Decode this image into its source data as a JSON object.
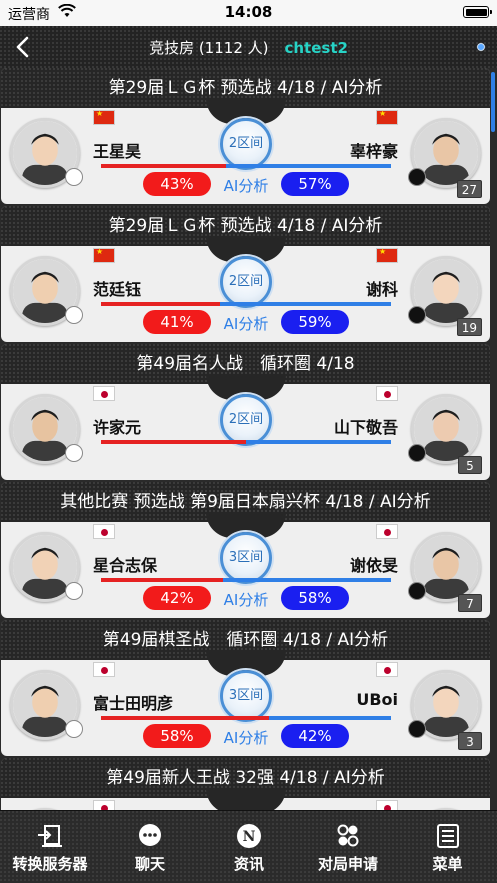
{
  "status_bar": {
    "carrier": "运营商",
    "time": "14:08"
  },
  "nav": {
    "room_title": "竞技房 (1112 人)",
    "user_name": "chtest2"
  },
  "ai_label": "AI分析",
  "games": [
    {
      "title": "第29届ＬＧ杯 预选战 4/18 / AI分析",
      "room": "2区间",
      "black_name": "王星昊",
      "white_name": "辜梓豪",
      "black_flag": "cn",
      "white_flag": "cn",
      "black_pct": "43%",
      "white_pct": "57%",
      "black_ratio": 0.43,
      "count": "27",
      "show_ai": true
    },
    {
      "title": "第29届ＬＧ杯 预选战 4/18 / AI分析",
      "room": "2区间",
      "black_name": "范廷钰",
      "white_name": "谢科",
      "black_flag": "cn",
      "white_flag": "cn",
      "black_pct": "41%",
      "white_pct": "59%",
      "black_ratio": 0.41,
      "count": "19",
      "show_ai": true
    },
    {
      "title": "第49届名人战　循环圈 4/18",
      "room": "2区间",
      "black_name": "许家元",
      "white_name": "山下敬吾",
      "black_flag": "jp",
      "white_flag": "jp",
      "black_pct": "",
      "white_pct": "",
      "black_ratio": 0.5,
      "count": "5",
      "show_ai": false
    },
    {
      "title": "其他比赛 预选战 第9届日本扇兴杯 4/18 / AI分析",
      "room": "3区间",
      "black_name": "星合志保",
      "white_name": "谢依旻",
      "black_flag": "jp",
      "white_flag": "jp",
      "black_pct": "42%",
      "white_pct": "58%",
      "black_ratio": 0.42,
      "count": "7",
      "show_ai": true
    },
    {
      "title": "第49届棋圣战　循环圈 4/18 / AI分析",
      "room": "3区间",
      "black_name": "富士田明彦",
      "white_name": "UBoi",
      "black_flag": "jp",
      "white_flag": "jp",
      "black_pct": "58%",
      "white_pct": "42%",
      "black_ratio": 0.58,
      "count": "3",
      "show_ai": true
    },
    {
      "title": "第49届新人王战 32强 4/18 / AI分析",
      "room": "",
      "black_name": "",
      "white_name": "",
      "black_flag": "jp",
      "white_flag": "jp",
      "black_pct": "",
      "white_pct": "",
      "black_ratio": 0.5,
      "count": "",
      "show_ai": false
    }
  ],
  "tabs": [
    {
      "label": "转换服务器",
      "icon": "switch-server-icon"
    },
    {
      "label": "聊天",
      "icon": "chat-icon"
    },
    {
      "label": "资讯",
      "icon": "news-icon"
    },
    {
      "label": "对局申请",
      "icon": "match-request-icon"
    },
    {
      "label": "菜单",
      "icon": "menu-icon"
    }
  ]
}
